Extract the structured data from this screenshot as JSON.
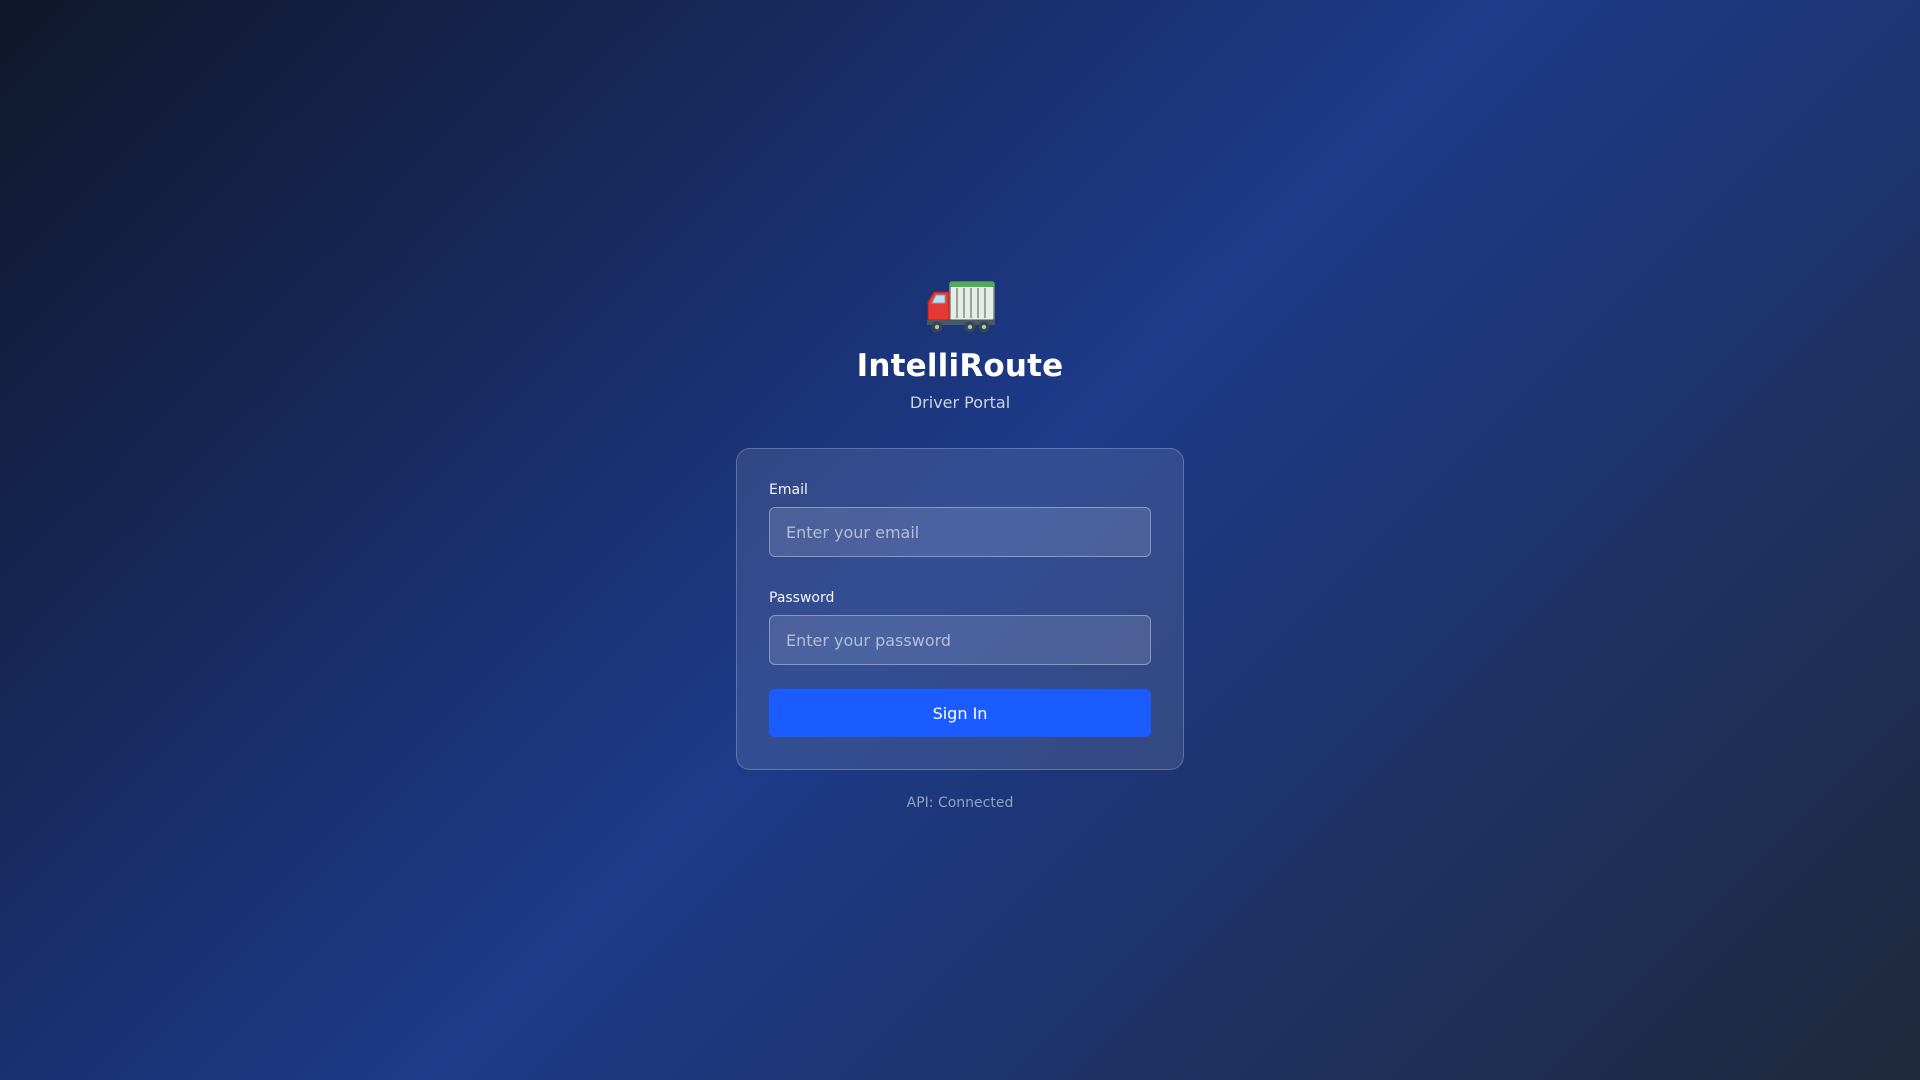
{
  "app": {
    "title": "IntelliRoute",
    "subtitle": "Driver Portal",
    "logo_icon": "truck-icon"
  },
  "login_form": {
    "email_label": "Email",
    "email_value": "",
    "email_placeholder": "Enter your email",
    "password_label": "Password",
    "password_value": "",
    "password_placeholder": "Enter your password",
    "submit_label": "Sign In"
  },
  "status": {
    "api_text": "API: Connected"
  },
  "colors": {
    "accent": "#1a5cff",
    "background_dark": "#0f172a",
    "background_mid": "#1e3a8a"
  }
}
